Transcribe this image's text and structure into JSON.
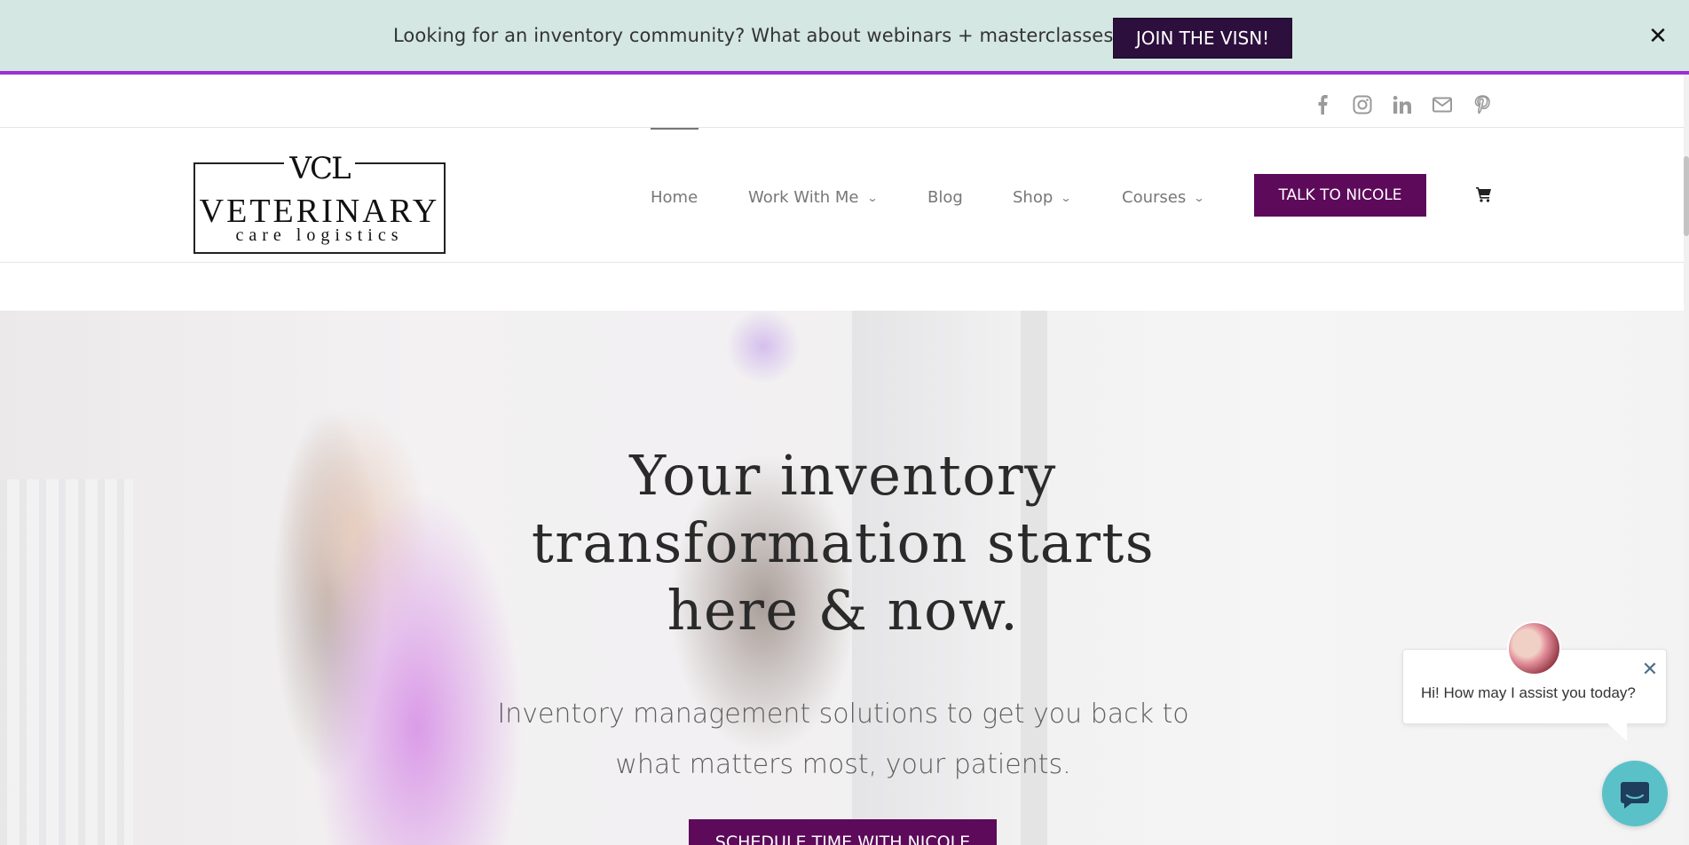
{
  "promo": {
    "text": "Looking for an inventory community? What about webinars + masterclasses?",
    "button": "JOIN THE VISN!",
    "close": "✕"
  },
  "social": [
    "facebook-icon",
    "instagram-icon",
    "linkedin-icon",
    "mail-icon",
    "pinterest-icon"
  ],
  "logo": {
    "mark": "VCL",
    "main": "VETERINARY",
    "sub": "care logistics"
  },
  "nav": {
    "items": [
      {
        "label": "Home",
        "has_dropdown": false
      },
      {
        "label": "Work With Me",
        "has_dropdown": true
      },
      {
        "label": "Blog",
        "has_dropdown": false
      },
      {
        "label": "Shop",
        "has_dropdown": true
      },
      {
        "label": "Courses",
        "has_dropdown": true
      }
    ],
    "cta": "TALK TO NICOLE",
    "cart_icon": "cart-icon"
  },
  "hero": {
    "title_lines": [
      "Your inventory",
      "transformation starts",
      "here & now."
    ],
    "subtitle_lines": [
      "Inventory management solutions to get you back to",
      "what matters most, your patients."
    ],
    "cta": "SCHEDULE TIME WITH NICOLE"
  },
  "chat": {
    "message": "Hi! How may I assist you today?",
    "close": "✕"
  },
  "colors": {
    "promo_bg": "#d4e7e2",
    "promo_border": "#9b2fd6",
    "promo_button": "#2c0f3c",
    "brand_purple": "#5d0a5a",
    "chat_teal": "#5bc1c9"
  }
}
